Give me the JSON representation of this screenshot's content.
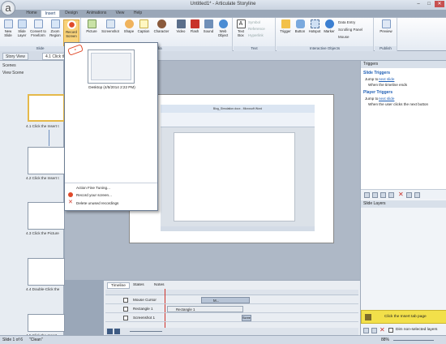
{
  "window": {
    "title": "Untitled1* - Articulate Storyline",
    "app_glyph": "a"
  },
  "tabs": [
    "Home",
    "Insert",
    "Design",
    "Animations",
    "View",
    "Help"
  ],
  "ribbon": {
    "slide_buttons": [
      "New Slide",
      "Slide Layer",
      "Convert to Freeform",
      "Zoom Region",
      "Record Screen"
    ],
    "slide_group": "Slide",
    "media_buttons": [
      "Picture",
      "Screenshot",
      "Shape",
      "Caption",
      "Character",
      "Video",
      "Flash",
      "Sound",
      "Web Object"
    ],
    "media_group": "Media",
    "text_buttons": [
      "Text Box"
    ],
    "text_small": [
      "Symbol",
      "Reference",
      "Hyperlink"
    ],
    "text_group": "Text",
    "interactive_buttons": [
      "Trigger",
      "Button",
      "Hotspot",
      "Marker"
    ],
    "interactive_small": [
      "Data Entry",
      "Scrolling Panel",
      "Mouse"
    ],
    "interactive_group": "Interactive Objects",
    "publish_buttons": [
      "Preview"
    ],
    "publish_group": "Publish"
  },
  "view_tabs": [
    "Story View",
    "4.1 Click the"
  ],
  "scenes": {
    "header": "Scenes",
    "view_scene": "View Scene",
    "slides": [
      "4.1 Click the Insert t",
      "4.2 Click the Insert t",
      "4.3 Click the Picture",
      "4.4 Double-Click the",
      "4.5 Click the Insert"
    ]
  },
  "popup": {
    "recording_label": "Desktop (4/5/2014 2:22 PM)",
    "menu": [
      "Action Fine Tuning...",
      "Record your screen...",
      "Delete unused recordings"
    ]
  },
  "document": {
    "title": "Blog_Simulation.docx - Microsoft Word"
  },
  "triggers": {
    "panel_title": "Triggers",
    "slide_triggers_title": "Slide Triggers",
    "slide_trigger_action": "Jump to",
    "slide_trigger_link": "next slide",
    "slide_trigger_when": "When the timeline ends",
    "player_triggers_title": "Player Triggers",
    "player_trigger_action": "Jump to",
    "player_trigger_link": "next slide",
    "player_trigger_when": "When the user clicks the next button"
  },
  "layers": {
    "panel_title": "Slide Layers",
    "base_layer": "Click the Insert tab page",
    "dim_label": "Dim non-selected layers"
  },
  "timeline": {
    "tabs": [
      "Timeline",
      "States",
      "Notes"
    ],
    "rows": [
      "Mouse Cursor",
      "Rectangle 1",
      "Screenshot 1"
    ],
    "bar_labels": [
      "M...",
      "Rectangle 1",
      "Screensh"
    ]
  },
  "status": {
    "slide": "Slide 1 of 6",
    "theme": "\"Clean\"",
    "zoom": "88%"
  },
  "colors": {
    "accent": "#1f5fb5",
    "record": "#e04a2a",
    "layer_yellow": "#f2e04a"
  }
}
